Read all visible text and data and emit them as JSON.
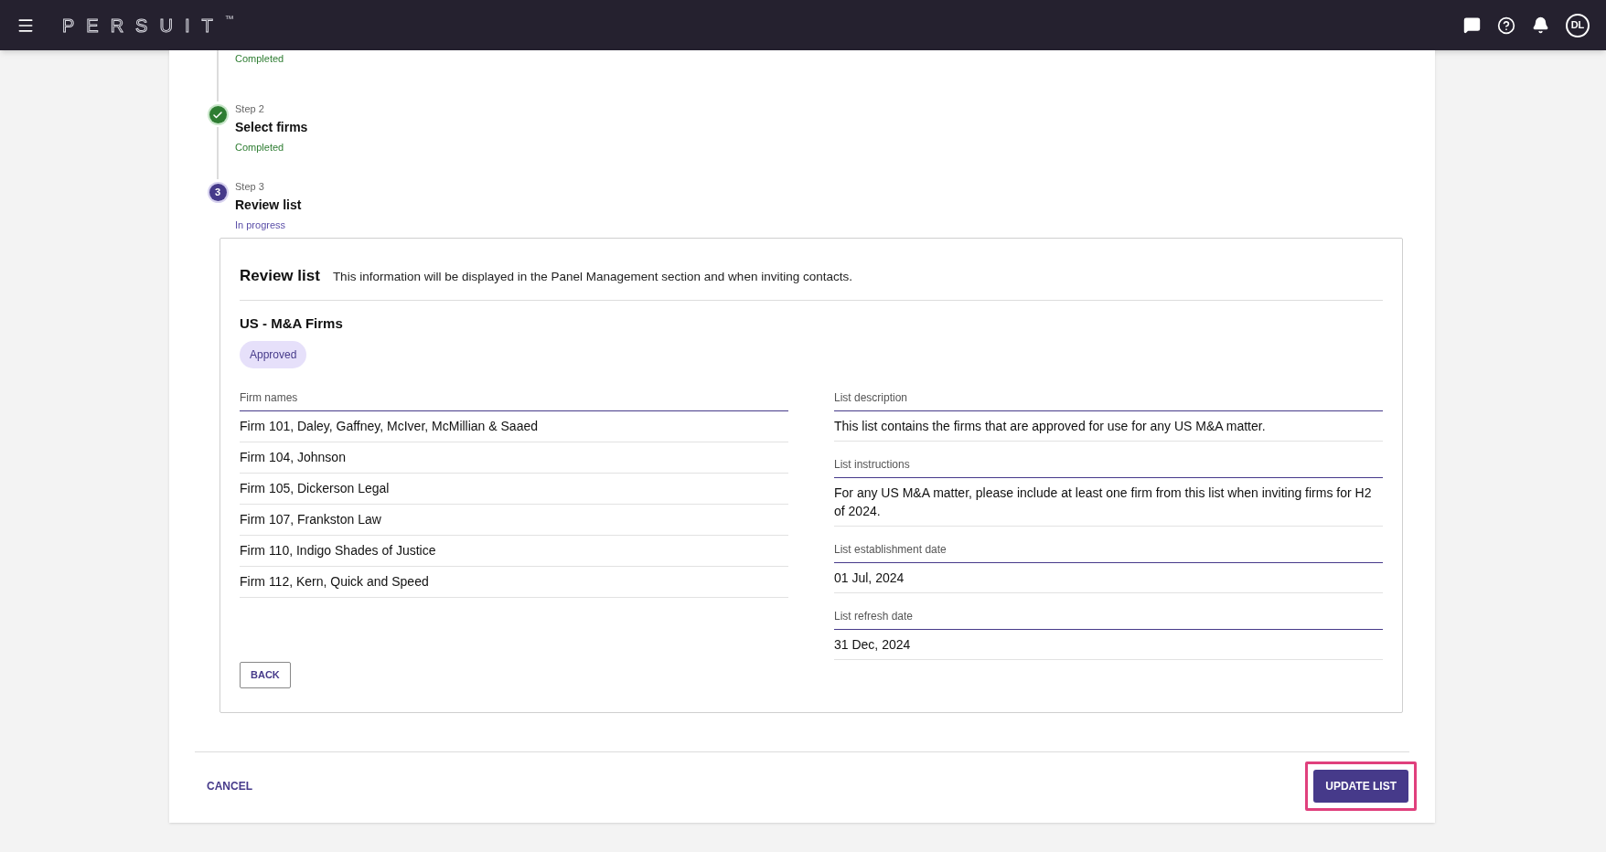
{
  "header": {
    "logo": "PERSUIT",
    "trademark": "™",
    "avatar": "DL"
  },
  "steps": [
    {
      "done": true,
      "status": "Completed"
    },
    {
      "done": true,
      "label": "Step 2",
      "title": "Select firms",
      "status": "Completed"
    },
    {
      "done": false,
      "number": "3",
      "label": "Step 3",
      "title": "Review list",
      "status": "In progress"
    }
  ],
  "review": {
    "title": "Review list",
    "subtitle": "This information will be displayed in the Panel Management section and when inviting contacts.",
    "list_name": "US - M&A Firms",
    "badge": "Approved",
    "firm_names": {
      "label": "Firm names",
      "rows": [
        "Firm 101, Daley, Gaffney, McIver, McMillian & Saaed",
        "Firm 104, Johnson",
        "Firm 105, Dickerson Legal",
        "Firm 107, Frankston Law",
        "Firm 110, Indigo Shades of Justice",
        "Firm 112, Kern, Quick and Speed"
      ]
    },
    "fields": [
      {
        "label": "List description",
        "value": "This list contains the firms that are approved for use for any US M&A matter."
      },
      {
        "label": "List instructions",
        "value": "For any US M&A matter, please include at least one firm from this list when inviting firms for H2 of 2024."
      },
      {
        "label": "List establishment date",
        "value": "01 Jul, 2024"
      },
      {
        "label": "List refresh date",
        "value": "31 Dec, 2024"
      }
    ],
    "back_button": "BACK"
  },
  "footer": {
    "cancel": "CANCEL",
    "submit": "UPDATE LIST",
    "submit_highlighted": true
  }
}
